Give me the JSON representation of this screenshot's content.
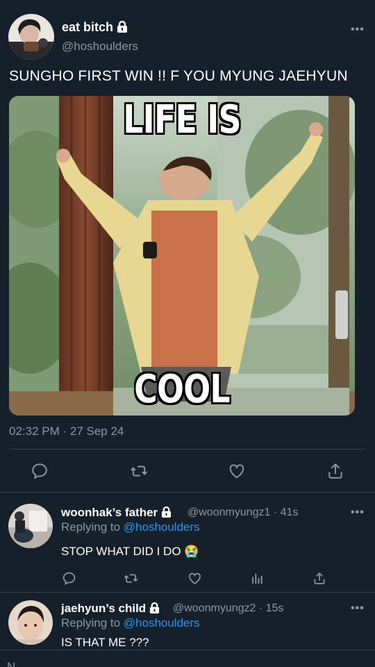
{
  "main_tweet": {
    "display_name": "eat bitch",
    "handle": "@hoshoulders",
    "text": "SUNGHO FIRST WIN !! F YOU MYUNG JAEHYUN",
    "meme_top": "LIFE IS",
    "meme_bottom": "COOL",
    "timestamp": "02:32 PM · 27 Sep 24",
    "more": "•••",
    "actions": [
      "reply-icon",
      "retweet-icon",
      "like-icon",
      "share-icon"
    ]
  },
  "replies": [
    {
      "display_name": "woonhak’s father",
      "handle": "@woonmyungz1",
      "time": "· 41s",
      "replying_prefix": "Replying to ",
      "replying_to": "@hoshoulders",
      "text": "STOP WHAT DID I DO 😭",
      "more": "•••",
      "actions": [
        "reply-icon",
        "retweet-icon",
        "like-icon",
        "analytics-icon",
        "share-icon"
      ]
    },
    {
      "display_name": "jaehyun’s child",
      "handle": "@woonmyungz2",
      "time": "· 15s",
      "replying_prefix": "Replying to ",
      "replying_to": "@hoshoulders",
      "text": "IS THAT ME ???",
      "more": "•••"
    }
  ],
  "footer_partial": "N"
}
